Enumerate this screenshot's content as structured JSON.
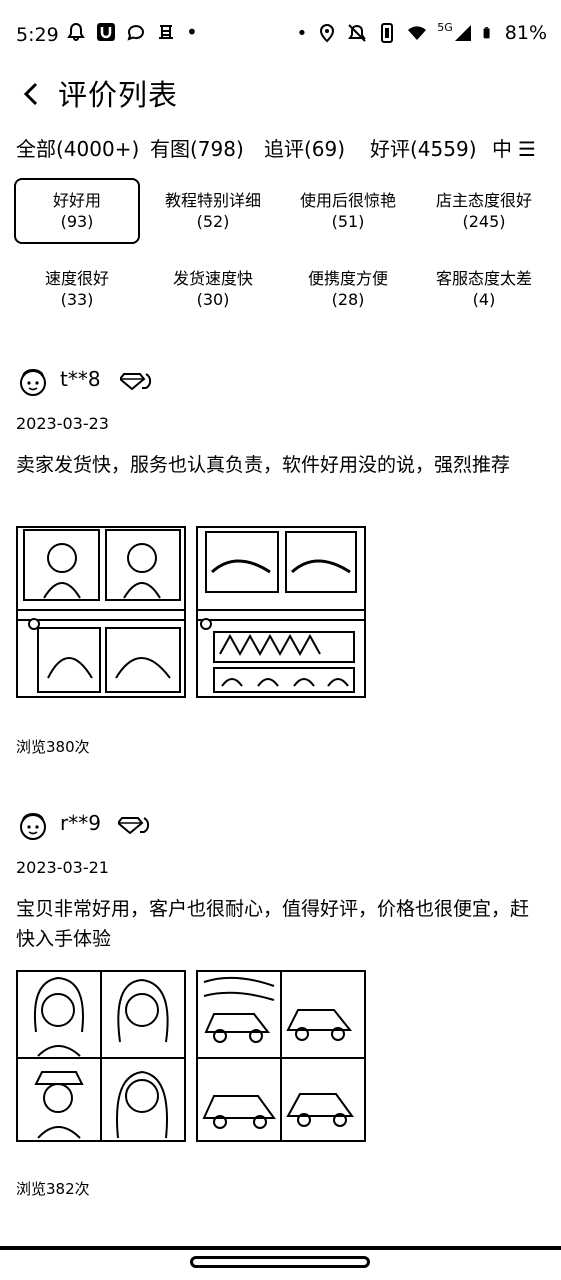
{
  "status_bar": {
    "time": "5:29",
    "network": "5G",
    "battery": "81%"
  },
  "header": {
    "title": "评价列表"
  },
  "tabs": [
    {
      "label": "全部(4000+)"
    },
    {
      "label": "有图(798)"
    },
    {
      "label": "追评(69)"
    },
    {
      "label": "好评(4559)"
    },
    {
      "label": "中"
    }
  ],
  "tags": [
    {
      "name": "好好用",
      "count": "(93)",
      "selected": true
    },
    {
      "name": "教程特别详细",
      "count": "(52)"
    },
    {
      "name": "使用后很惊艳",
      "count": "(51)"
    },
    {
      "name": "店主态度很好",
      "count": "(245)"
    },
    {
      "name": "速度很好",
      "count": "(33)"
    },
    {
      "name": "发货速度快",
      "count": "(30)"
    },
    {
      "name": "便携度方便",
      "count": "(28)"
    },
    {
      "name": "客服态度太差",
      "count": "(4)"
    }
  ],
  "reviews": [
    {
      "username": "t**8",
      "date": "2023-03-23",
      "content": "卖家发货快，服务也认真负责，软件好用没的说，强烈推荐",
      "views": "浏览380次"
    },
    {
      "username": "r**9",
      "date": "2023-03-21",
      "content": "宝贝非常好用，客户也很耐心，值得好评，价格也很便宜，赶快入手体验",
      "views": "浏览382次"
    }
  ]
}
